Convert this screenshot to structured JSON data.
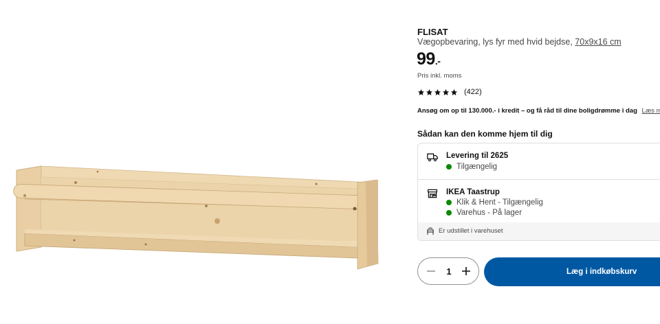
{
  "product": {
    "name": "FLISAT",
    "description": "Vægopbevaring, lys fyr med hvid bejdse,",
    "dimensions": "70x9x16 cm",
    "price": "99",
    "price_suffix": ".-",
    "price_note": "Pris inkl. moms",
    "image_icon": "wooden-wall-shelf-image"
  },
  "rating": {
    "stars": 5,
    "count": "(422)"
  },
  "credit": {
    "text": "Ansøg om op til 130.000.- i kredit – og få råd til dine boligdrømme i dag",
    "link": "Læs mere"
  },
  "delivery": {
    "heading": "Sådan kan den komme hjem til dig",
    "shipping": {
      "icon": "truck-icon",
      "title": "Levering til 2625",
      "status": "Tilgængelig"
    },
    "store": {
      "icon": "store-icon",
      "title": "IKEA Taastrup",
      "click_collect": "Klik & Hent - Tilgængelig",
      "warehouse": "Varehus - På lager"
    },
    "showroom": {
      "icon": "showroom-icon",
      "text": "Er udstillet i varehuset"
    }
  },
  "cart": {
    "quantity": "1",
    "add_label": "Læg i indkøbskurv"
  },
  "colors": {
    "accent": "#0058a3",
    "available": "#0a8a00"
  }
}
